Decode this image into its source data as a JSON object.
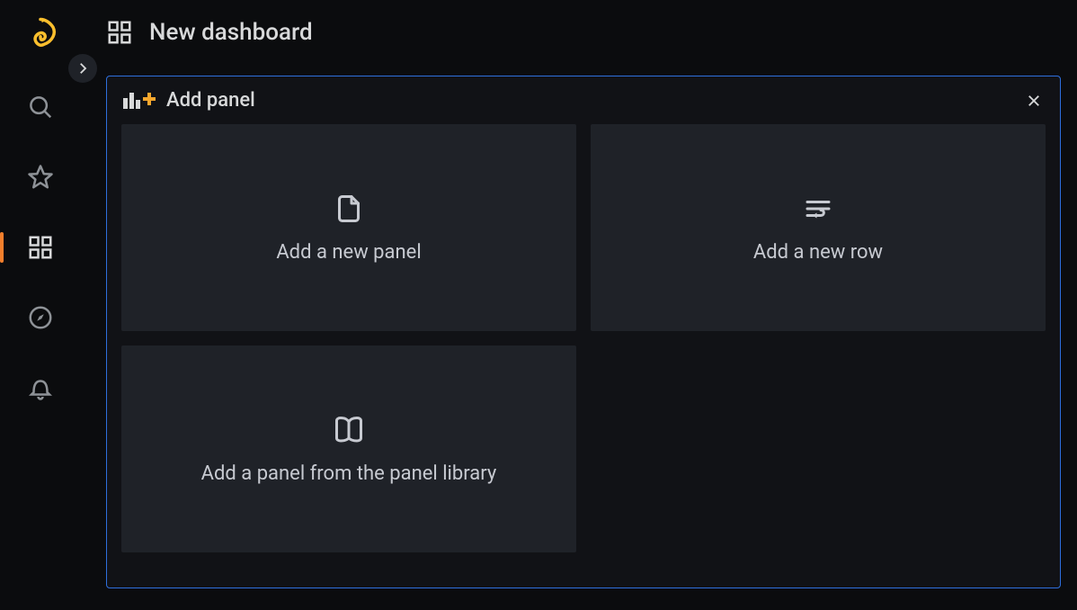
{
  "header": {
    "title": "New dashboard"
  },
  "addPanel": {
    "title": "Add panel",
    "options": {
      "newPanel": "Add a new panel",
      "newRow": "Add a new row",
      "panelLibrary": "Add a panel from the panel library"
    }
  },
  "sidebar": {
    "items": [
      "search",
      "starred",
      "dashboards",
      "explore",
      "alerting"
    ]
  }
}
